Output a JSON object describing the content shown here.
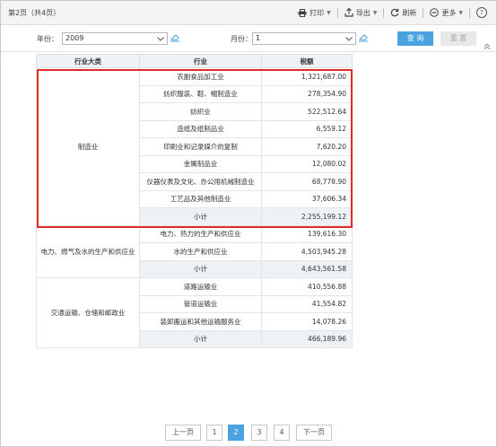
{
  "toolbar": {
    "page_info": "第2页（共4页）",
    "print": "打印",
    "export": "导出",
    "refresh": "刷新",
    "more": "更多"
  },
  "filter": {
    "year_label": "年份：",
    "year_value": "2009",
    "month_label": "月份：",
    "month_value": "1",
    "query_button": "查 询",
    "reset_button": "重 置"
  },
  "table": {
    "headers": [
      "行业大类",
      "行业",
      "税额"
    ],
    "groups": [
      {
        "category": "制造业",
        "rows": [
          {
            "industry": "农副食品加工业",
            "tax": "1,321,687.00"
          },
          {
            "industry": "纺织服装、鞋、帽制造业",
            "tax": "278,354.90"
          },
          {
            "industry": "纺织业",
            "tax": "522,512.64"
          },
          {
            "industry": "造纸及纸制品业",
            "tax": "6,559.12"
          },
          {
            "industry": "印刷业和记录媒介的复制",
            "tax": "7,620.20"
          },
          {
            "industry": "金属制品业",
            "tax": "12,080.02"
          },
          {
            "industry": "仪器仪表及文化、办公用机械制造业",
            "tax": "68,778.90"
          },
          {
            "industry": "工艺品及其他制造业",
            "tax": "37,606.34"
          }
        ],
        "subtotal_label": "小计",
        "subtotal": "2,255,199.12"
      },
      {
        "category": "电力、燃气及水的生产和供应业",
        "rows": [
          {
            "industry": "电力、热力的生产和供应业",
            "tax": "139,616.30"
          },
          {
            "industry": "水的生产和供应业",
            "tax": "4,503,945.28"
          }
        ],
        "subtotal_label": "小计",
        "subtotal": "4,643,561.58"
      },
      {
        "category": "交通运输、仓储和邮政业",
        "rows": [
          {
            "industry": "道路运输业",
            "tax": "410,556.88"
          },
          {
            "industry": "管道运输业",
            "tax": "41,554.82"
          },
          {
            "industry": "装卸搬运和其他运输服务业",
            "tax": "14,078.26"
          }
        ],
        "subtotal_label": "小计",
        "subtotal": "466,189.96"
      }
    ]
  },
  "pagination": {
    "prev": "上一页",
    "pages": [
      "1",
      "2",
      "3",
      "4"
    ],
    "current": "2",
    "next": "下一页"
  },
  "colors": {
    "accent": "#4aa3df",
    "highlight_border": "#e02b2b",
    "header_bg": "#f0f3f5"
  }
}
